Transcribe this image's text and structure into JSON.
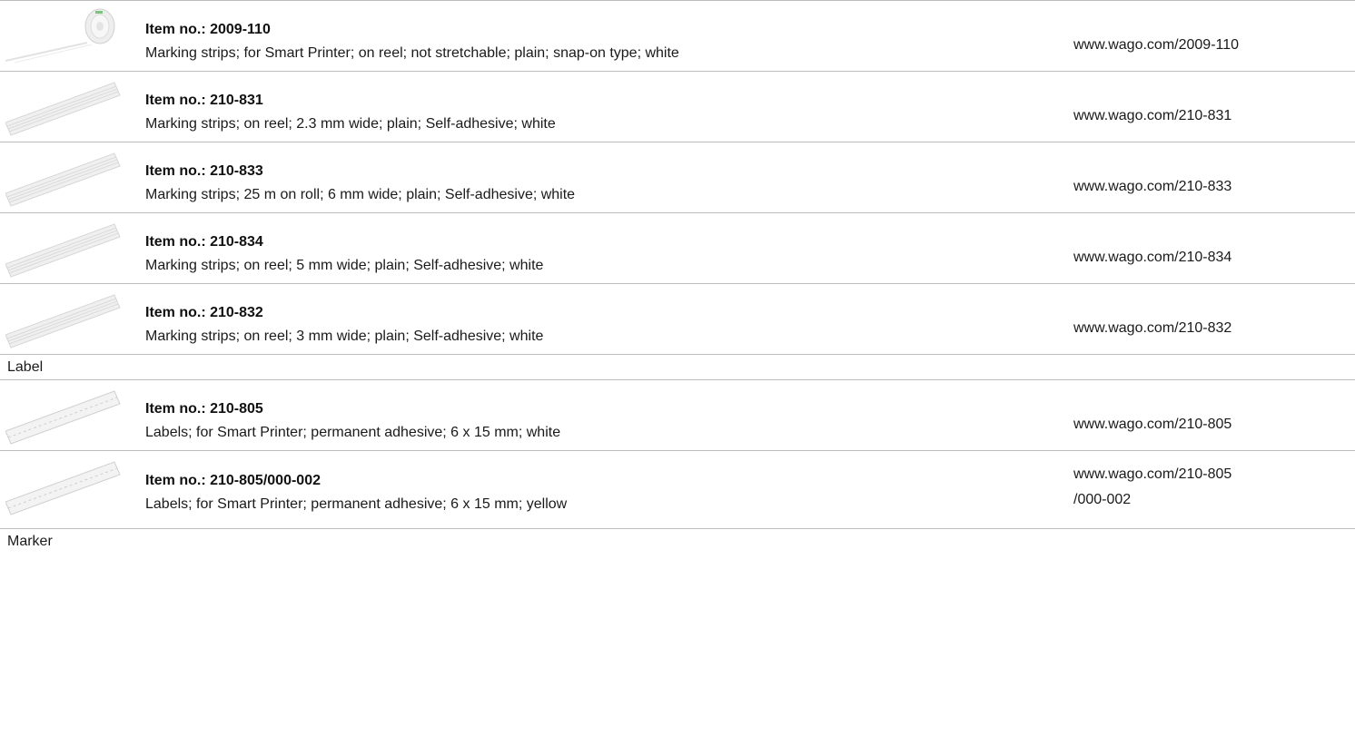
{
  "sections": [
    {
      "label": "",
      "items": [
        {
          "item_no": "Item no.: 2009-110",
          "description": "Marking strips; for Smart Printer; on reel; not stretchable; plain; snap-on type; white",
          "url": "www.wago.com/2009-110",
          "image": "reel-image"
        },
        {
          "item_no": "Item no.: 210-831",
          "description": "Marking strips; on reel; 2.3 mm wide; plain; Self-adhesive; white",
          "url": "www.wago.com/210-831",
          "image": "strip-image"
        },
        {
          "item_no": "Item no.: 210-833",
          "description": "Marking strips; 25  m on roll; 6 mm wide; plain; Self-adhesive; white",
          "url": "www.wago.com/210-833",
          "image": "strip-image"
        },
        {
          "item_no": "Item no.: 210-834",
          "description": "Marking strips; on reel; 5 mm wide; plain; Self-adhesive; white",
          "url": "www.wago.com/210-834",
          "image": "strip-image"
        },
        {
          "item_no": "Item no.: 210-832",
          "description": "Marking strips; on reel; 3 mm wide; plain; Self-adhesive; white",
          "url": "www.wago.com/210-832",
          "image": "strip-image"
        }
      ]
    },
    {
      "label": "Label",
      "items": [
        {
          "item_no": "Item no.: 210-805",
          "description": "Labels; for Smart Printer; permanent adhesive; 6 x 15 mm; white",
          "url": "www.wago.com/210-805",
          "image": "label-strip-image"
        },
        {
          "item_no": "Item no.: 210-805/000-002",
          "description": "Labels; for Smart Printer; permanent adhesive; 6 x 15 mm; yellow",
          "url_line1": "www.wago.com/210-805",
          "url_line2": "/000-002",
          "image": "label-strip-image"
        }
      ]
    },
    {
      "label": "Marker",
      "items": []
    }
  ]
}
